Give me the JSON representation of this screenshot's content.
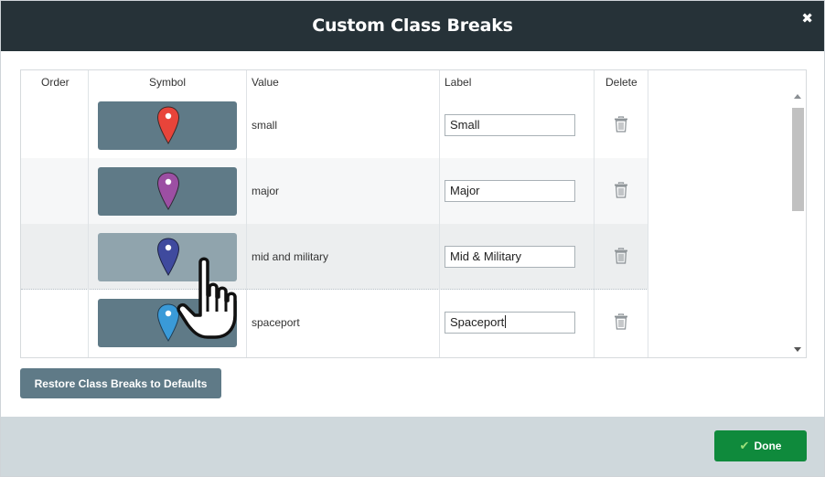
{
  "dialog": {
    "title": "Custom Class Breaks",
    "close_symbol": "✖"
  },
  "table": {
    "headers": {
      "order": "Order",
      "symbol": "Symbol",
      "value": "Value",
      "label": "Label",
      "delete": "Delete"
    },
    "rows": [
      {
        "value": "small",
        "label": "Small",
        "pin_color": "#e8443a"
      },
      {
        "value": "major",
        "label": "Major",
        "pin_color": "#9c4fa3"
      },
      {
        "value": "mid and military",
        "label": "Mid & Military",
        "pin_color": "#3f4a9e"
      },
      {
        "value": "spaceport",
        "label": "Spaceport",
        "pin_color": "#3a9ad8"
      }
    ]
  },
  "buttons": {
    "restore": "Restore Class Breaks to Defaults",
    "done": "Done",
    "done_icon": "✔"
  },
  "icons": {
    "delete": "trash-icon",
    "cursor": "hand-pointer-icon"
  },
  "colors": {
    "header_bg": "#263238",
    "swatch_bg": "#5f7a87",
    "done_green": "#0f8a3c",
    "footer_bg": "#cfd8dc"
  }
}
